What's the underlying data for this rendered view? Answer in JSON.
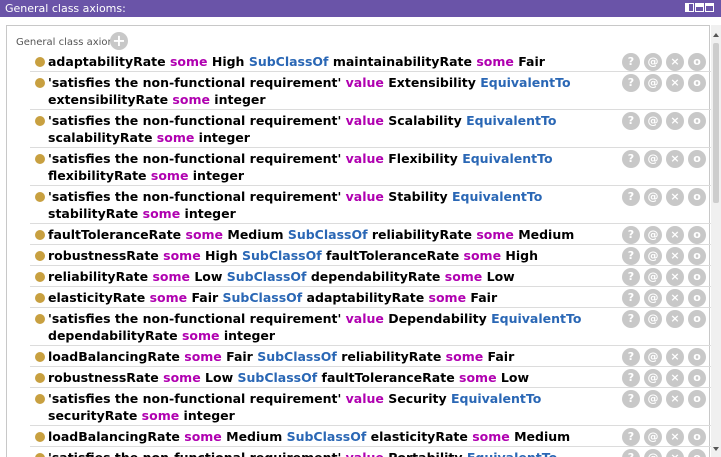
{
  "titlebar": {
    "title": "General class axioms:"
  },
  "section": {
    "header": "General class axioms"
  },
  "axioms": [
    {
      "parts": [
        [
          "adaptabilityRate",
          ""
        ],
        [
          " some ",
          "kw"
        ],
        [
          "High ",
          ""
        ],
        [
          "SubClassOf",
          "op"
        ],
        [
          " maintainabilityRate ",
          ""
        ],
        [
          "some",
          "kw"
        ],
        [
          " Fair",
          ""
        ]
      ]
    },
    {
      "parts": [
        [
          "'satisfies the non-functional requirement' ",
          ""
        ],
        [
          "value",
          "kw"
        ],
        [
          " Extensibility ",
          ""
        ],
        [
          "EquivalentTo",
          "op"
        ],
        [
          " extensibilityRate ",
          ""
        ],
        [
          "some",
          "kw"
        ],
        [
          " integer",
          ""
        ]
      ]
    },
    {
      "parts": [
        [
          "'satisfies the non-functional requirement' ",
          ""
        ],
        [
          "value",
          "kw"
        ],
        [
          " Scalability ",
          ""
        ],
        [
          "EquivalentTo",
          "op"
        ],
        [
          " scalabilityRate ",
          ""
        ],
        [
          "some",
          "kw"
        ],
        [
          " integer",
          ""
        ]
      ]
    },
    {
      "parts": [
        [
          "'satisfies the non-functional requirement' ",
          ""
        ],
        [
          "value",
          "kw"
        ],
        [
          " Flexibility ",
          ""
        ],
        [
          "EquivalentTo",
          "op"
        ],
        [
          " flexibilityRate ",
          ""
        ],
        [
          "some",
          "kw"
        ],
        [
          " integer",
          ""
        ]
      ]
    },
    {
      "parts": [
        [
          "'satisfies the non-functional requirement' ",
          ""
        ],
        [
          "value",
          "kw"
        ],
        [
          " Stability ",
          ""
        ],
        [
          "EquivalentTo",
          "op"
        ],
        [
          " stabilityRate ",
          ""
        ],
        [
          "some",
          "kw"
        ],
        [
          " integer",
          ""
        ]
      ]
    },
    {
      "parts": [
        [
          "faultToleranceRate",
          ""
        ],
        [
          " some ",
          "kw"
        ],
        [
          "Medium ",
          ""
        ],
        [
          "SubClassOf",
          "op"
        ],
        [
          " reliabilityRate ",
          ""
        ],
        [
          "some",
          "kw"
        ],
        [
          " Medium",
          ""
        ]
      ]
    },
    {
      "parts": [
        [
          "robustnessRate",
          ""
        ],
        [
          " some ",
          "kw"
        ],
        [
          "High ",
          ""
        ],
        [
          "SubClassOf",
          "op"
        ],
        [
          " faultToleranceRate ",
          ""
        ],
        [
          "some",
          "kw"
        ],
        [
          " High",
          ""
        ]
      ]
    },
    {
      "parts": [
        [
          "reliabilityRate",
          ""
        ],
        [
          " some ",
          "kw"
        ],
        [
          "Low ",
          ""
        ],
        [
          "SubClassOf",
          "op"
        ],
        [
          " dependabilityRate ",
          ""
        ],
        [
          "some",
          "kw"
        ],
        [
          " Low",
          ""
        ]
      ]
    },
    {
      "parts": [
        [
          "elasticityRate",
          ""
        ],
        [
          " some ",
          "kw"
        ],
        [
          "Fair ",
          ""
        ],
        [
          "SubClassOf",
          "op"
        ],
        [
          " adaptabilityRate ",
          ""
        ],
        [
          "some",
          "kw"
        ],
        [
          " Fair",
          ""
        ]
      ]
    },
    {
      "parts": [
        [
          "'satisfies the non-functional requirement' ",
          ""
        ],
        [
          "value",
          "kw"
        ],
        [
          " Dependability ",
          ""
        ],
        [
          "EquivalentTo",
          "op"
        ],
        [
          " dependabilityRate ",
          ""
        ],
        [
          "some",
          "kw"
        ],
        [
          " integer",
          ""
        ]
      ]
    },
    {
      "parts": [
        [
          "loadBalancingRate",
          ""
        ],
        [
          " some ",
          "kw"
        ],
        [
          "Fair ",
          ""
        ],
        [
          "SubClassOf",
          "op"
        ],
        [
          " reliabilityRate ",
          ""
        ],
        [
          "some",
          "kw"
        ],
        [
          " Fair",
          ""
        ]
      ]
    },
    {
      "parts": [
        [
          "robustnessRate",
          ""
        ],
        [
          " some ",
          "kw"
        ],
        [
          "Low ",
          ""
        ],
        [
          "SubClassOf",
          "op"
        ],
        [
          " faultToleranceRate ",
          ""
        ],
        [
          "some",
          "kw"
        ],
        [
          " Low",
          ""
        ]
      ]
    },
    {
      "parts": [
        [
          "'satisfies the non-functional requirement' ",
          ""
        ],
        [
          "value",
          "kw"
        ],
        [
          " Security ",
          ""
        ],
        [
          "EquivalentTo",
          "op"
        ],
        [
          " securityRate ",
          ""
        ],
        [
          "some",
          "kw"
        ],
        [
          " integer",
          ""
        ]
      ]
    },
    {
      "parts": [
        [
          "loadBalancingRate",
          ""
        ],
        [
          " some ",
          "kw"
        ],
        [
          "Medium ",
          ""
        ],
        [
          "SubClassOf",
          "op"
        ],
        [
          " elasticityRate ",
          ""
        ],
        [
          "some",
          "kw"
        ],
        [
          " Medium",
          ""
        ]
      ]
    },
    {
      "parts": [
        [
          "'satisfies the non-functional requirement' ",
          ""
        ],
        [
          "value",
          "kw"
        ],
        [
          " Portability ",
          ""
        ],
        [
          "EquivalentTo",
          "op"
        ]
      ]
    }
  ],
  "row_buttons": [
    "?",
    "@",
    "×",
    "o"
  ],
  "add_label": "+",
  "colors": {
    "titlebar": "#6a54a8",
    "keyword": "#b000b0",
    "operator": "#2a67b5",
    "dot": "#c8a040"
  }
}
